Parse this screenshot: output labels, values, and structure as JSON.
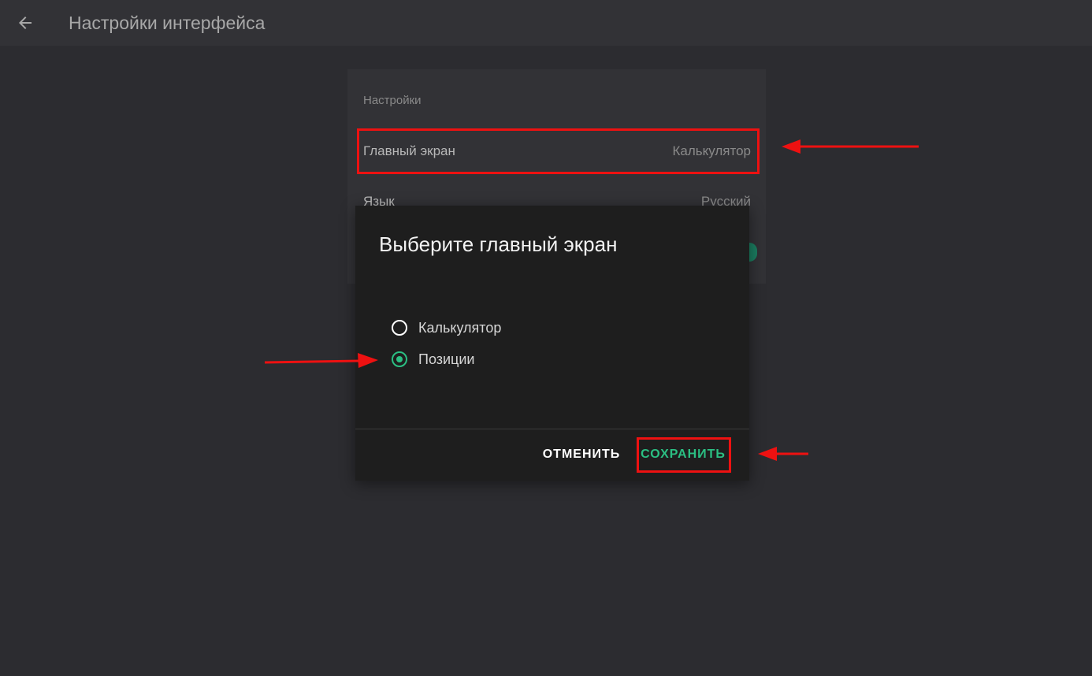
{
  "header": {
    "title": "Настройки интерфейса",
    "back_icon": "arrow-left-icon"
  },
  "settings": {
    "section_label": "Настройки",
    "rows": [
      {
        "key": "Главный экран",
        "value": "Калькулятор"
      },
      {
        "key": "Язык",
        "value": "Русский"
      }
    ]
  },
  "dialog": {
    "title": "Выберите главный экран",
    "options": [
      {
        "label": "Калькулятор",
        "selected": false
      },
      {
        "label": "Позиции",
        "selected": true
      }
    ],
    "cancel_label": "ОТМЕНИТЬ",
    "save_label": "СОХРАНИТЬ"
  },
  "colors": {
    "background": "#2c2c30",
    "card": "#323236",
    "dialog": "#1e1e1e",
    "accent": "#2bbf83",
    "annotation": "#ee1111"
  }
}
